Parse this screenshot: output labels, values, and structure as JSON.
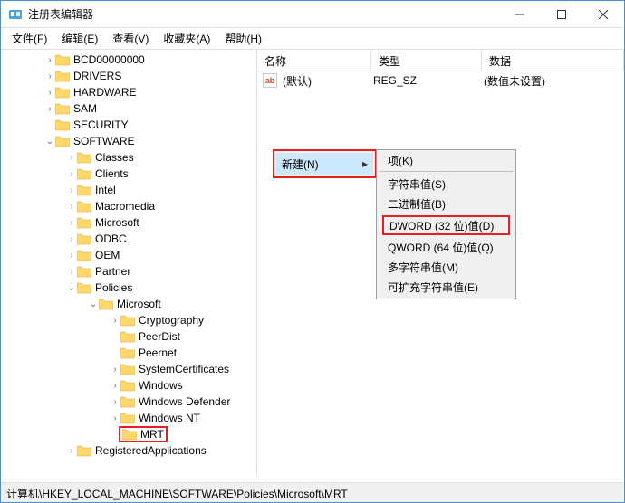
{
  "title": "注册表编辑器",
  "menu": {
    "file": "文件(F)",
    "edit": "编辑(E)",
    "view": "查看(V)",
    "fav": "收藏夹(A)",
    "help": "帮助(H)"
  },
  "tree": [
    {
      "indent": 2,
      "expander": ">",
      "label": "BCD00000000"
    },
    {
      "indent": 2,
      "expander": ">",
      "label": "DRIVERS"
    },
    {
      "indent": 2,
      "expander": ">",
      "label": "HARDWARE"
    },
    {
      "indent": 2,
      "expander": ">",
      "label": "SAM"
    },
    {
      "indent": 2,
      "expander": " ",
      "label": "SECURITY"
    },
    {
      "indent": 2,
      "expander": "v",
      "label": "SOFTWARE"
    },
    {
      "indent": 3,
      "expander": ">",
      "label": "Classes"
    },
    {
      "indent": 3,
      "expander": ">",
      "label": "Clients"
    },
    {
      "indent": 3,
      "expander": ">",
      "label": "Intel"
    },
    {
      "indent": 3,
      "expander": ">",
      "label": "Macromedia"
    },
    {
      "indent": 3,
      "expander": ">",
      "label": "Microsoft"
    },
    {
      "indent": 3,
      "expander": ">",
      "label": "ODBC"
    },
    {
      "indent": 3,
      "expander": ">",
      "label": "OEM"
    },
    {
      "indent": 3,
      "expander": ">",
      "label": "Partner"
    },
    {
      "indent": 3,
      "expander": "v",
      "label": "Policies"
    },
    {
      "indent": 4,
      "expander": "v",
      "label": "Microsoft"
    },
    {
      "indent": 5,
      "expander": ">",
      "label": "Cryptography"
    },
    {
      "indent": 5,
      "expander": " ",
      "label": "PeerDist"
    },
    {
      "indent": 5,
      "expander": " ",
      "label": "Peernet"
    },
    {
      "indent": 5,
      "expander": ">",
      "label": "SystemCertificates"
    },
    {
      "indent": 5,
      "expander": ">",
      "label": "Windows"
    },
    {
      "indent": 5,
      "expander": ">",
      "label": "Windows Defender"
    },
    {
      "indent": 5,
      "expander": ">",
      "label": "Windows NT"
    },
    {
      "indent": 5,
      "expander": " ",
      "label": "MRT",
      "hl": true
    },
    {
      "indent": 3,
      "expander": ">",
      "label": "RegisteredApplications"
    }
  ],
  "list": {
    "headers": {
      "name": "名称",
      "type": "类型",
      "data": "数据"
    },
    "rows": [
      {
        "name": "(默认)",
        "type": "REG_SZ",
        "data": "(数值未设置)"
      }
    ]
  },
  "ctx": {
    "primary": {
      "new": "新建(N)"
    },
    "secondary": [
      {
        "label": "项(K)"
      },
      {
        "label": "字符串值(S)"
      },
      {
        "label": "二进制值(B)"
      },
      {
        "label": "DWORD (32 位)值(D)",
        "hl": true
      },
      {
        "label": "QWORD (64 位)值(Q)"
      },
      {
        "label": "多字符串值(M)"
      },
      {
        "label": "可扩充字符串值(E)"
      }
    ]
  },
  "status": "计算机\\HKEY_LOCAL_MACHINE\\SOFTWARE\\Policies\\Microsoft\\MRT"
}
